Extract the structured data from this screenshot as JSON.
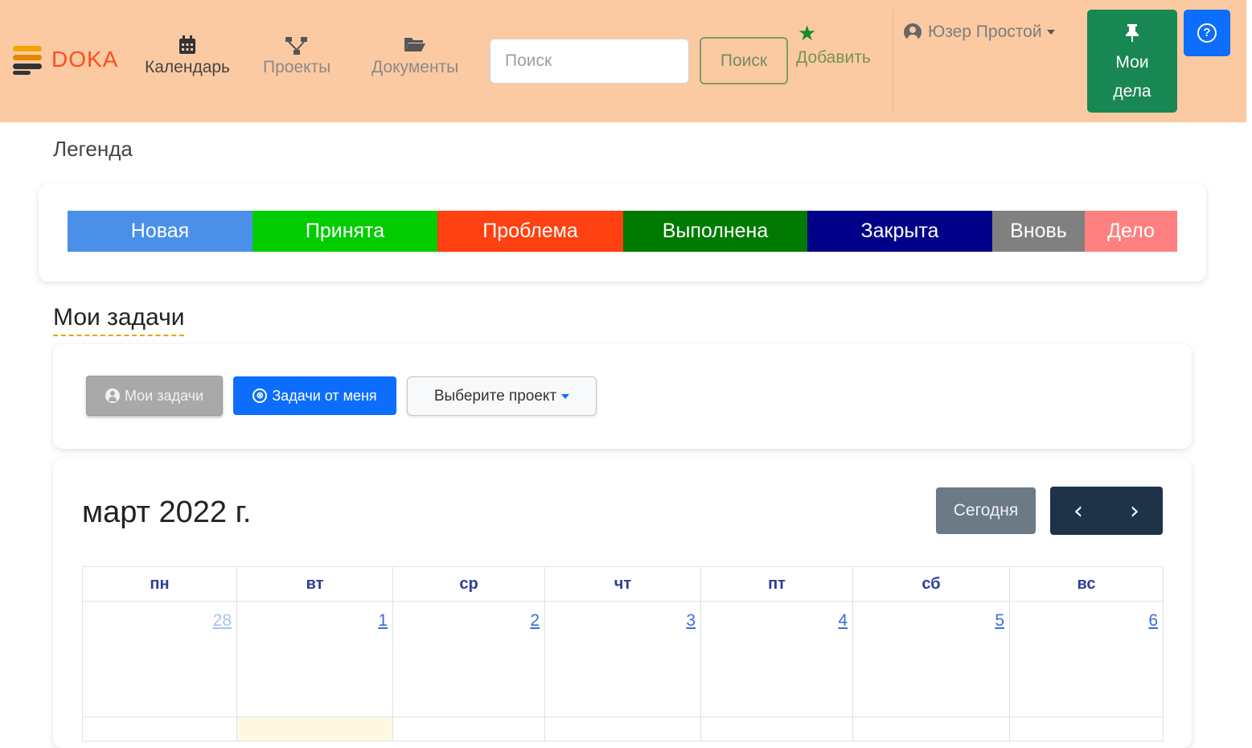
{
  "navbar": {
    "brand": "DOKA",
    "items": [
      {
        "label": "Календарь",
        "icon": "calendar-icon"
      },
      {
        "label": "Проекты",
        "icon": "sitemap-icon"
      },
      {
        "label": "Документы",
        "icon": "folder-open-icon"
      }
    ],
    "search_placeholder": "Поиск",
    "search_button": "Поиск",
    "add_label": "Добавить",
    "user_name": "Юзер Простой",
    "my_deals_line1": "Мои",
    "my_deals_line2": "дела"
  },
  "legend": {
    "title": "Легенда",
    "items": [
      {
        "label": "Новая",
        "color": "#4a90e8"
      },
      {
        "label": "Принята",
        "color": "#00cc00"
      },
      {
        "label": "Проблема",
        "color": "#ff4010"
      },
      {
        "label": "Выполнена",
        "color": "#007a00"
      },
      {
        "label": "Закрыта",
        "color": "#000088"
      },
      {
        "label": "Вновь",
        "color": "#808080"
      },
      {
        "label": "Дело",
        "color": "#ff8080"
      }
    ]
  },
  "tasks": {
    "title": "Мои задачи",
    "my_tasks_button": "Мои задачи",
    "tasks_from_me_button": "Задачи от меня",
    "select_project_button": "Выберите проект"
  },
  "calendar": {
    "title": "март 2022 г.",
    "today_button": "Сегодня",
    "prev_arrow": "‹",
    "next_arrow": "›",
    "weekdays": [
      "пн",
      "вт",
      "ср",
      "чт",
      "пт",
      "сб",
      "вс"
    ],
    "first_week": [
      "28",
      "1",
      "2",
      "3",
      "4",
      "5",
      "6"
    ]
  }
}
